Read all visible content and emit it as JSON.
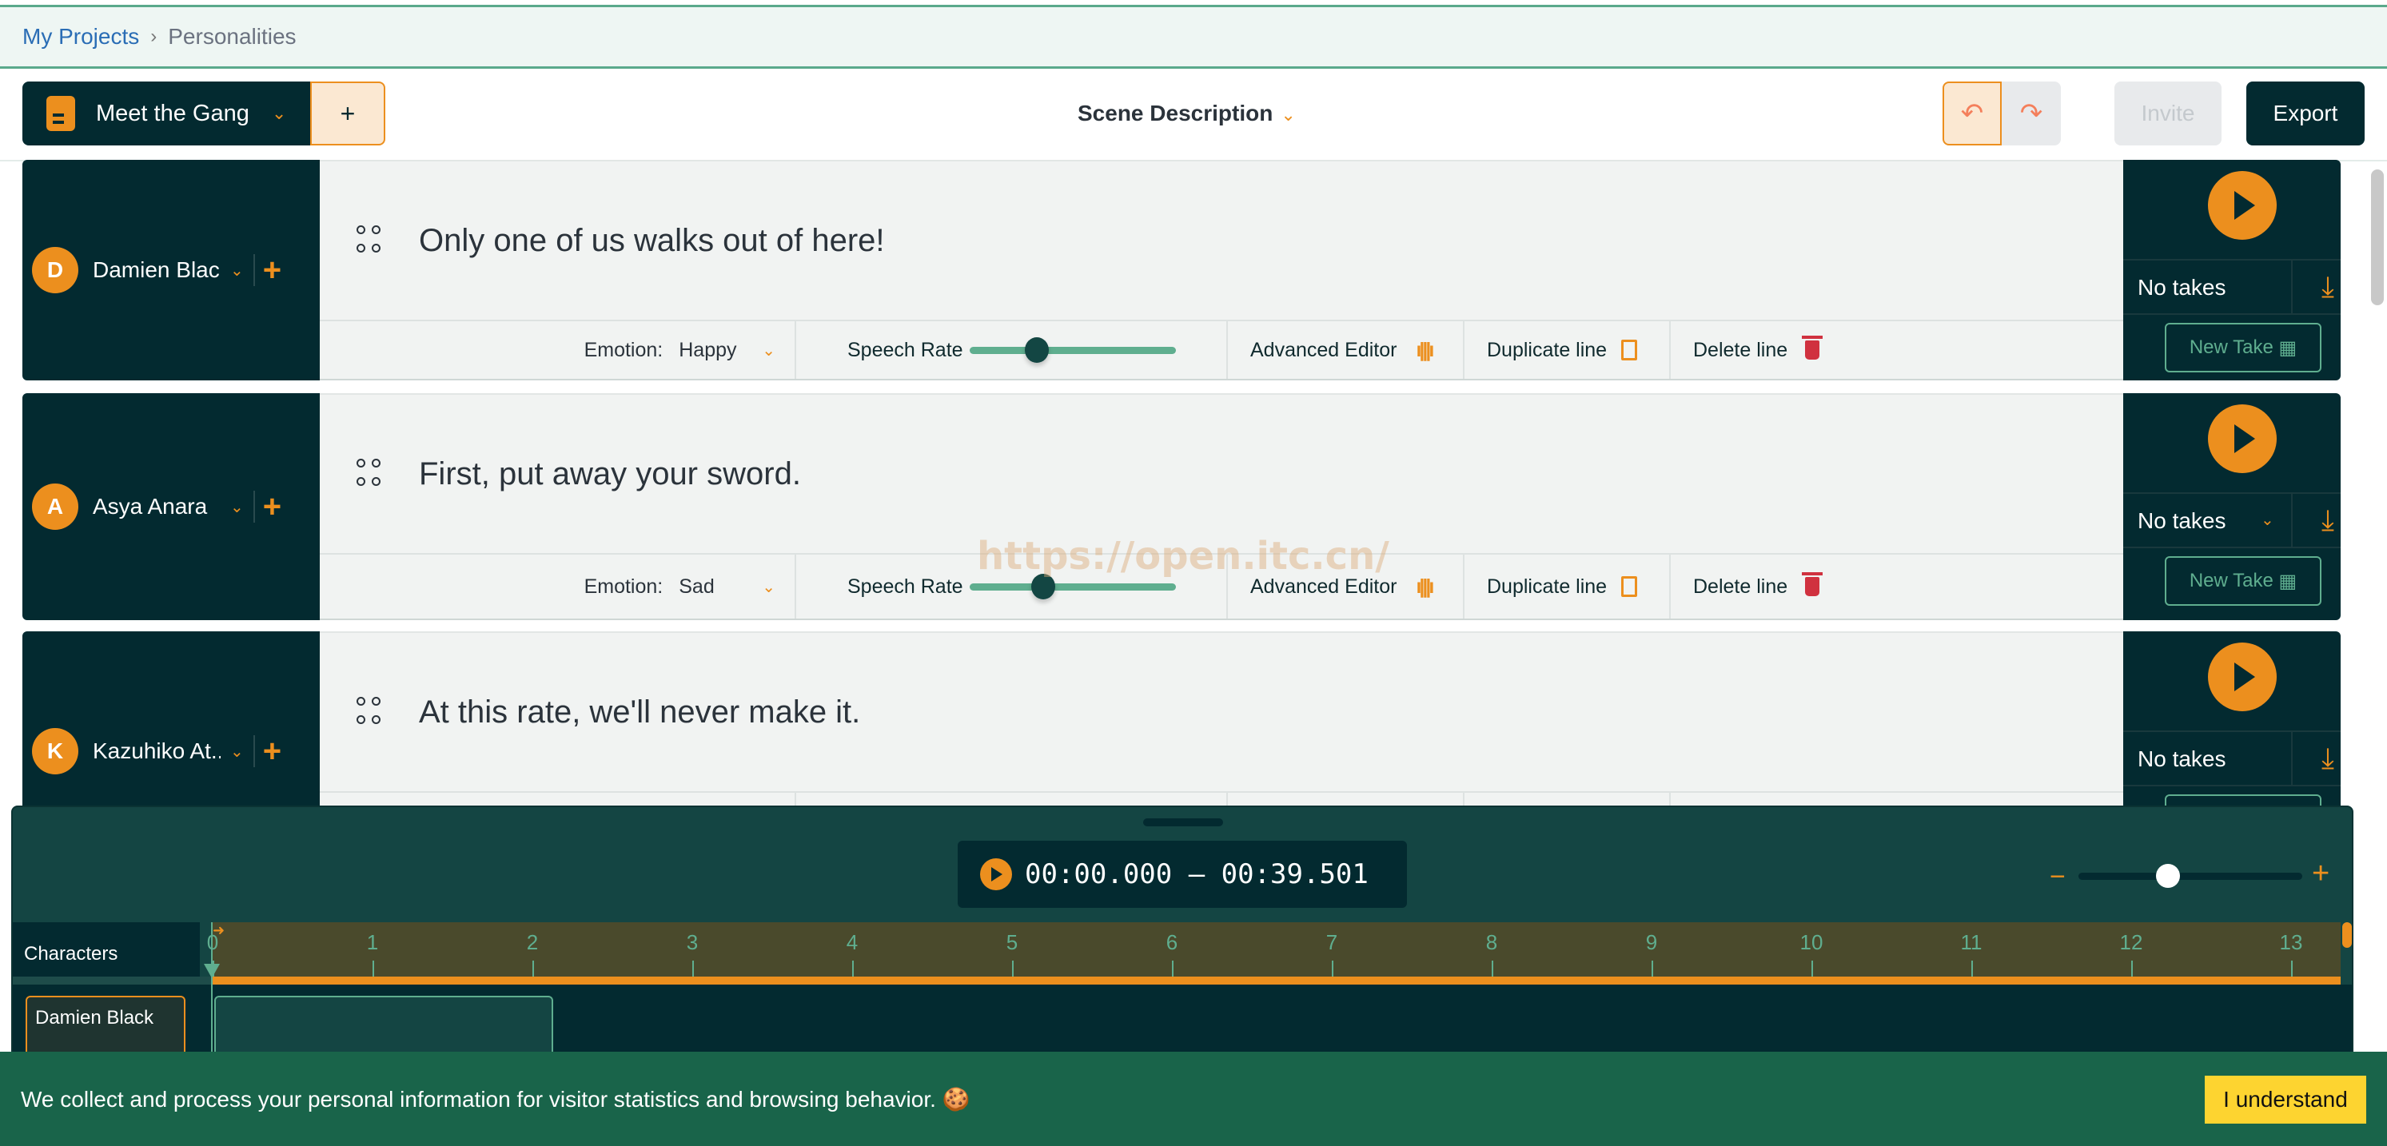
{
  "breadcrumb": {
    "root": "My Projects",
    "separator": "›",
    "current": "Personalities"
  },
  "toolbar": {
    "project_name": "Meet the Gang",
    "add_label": "+",
    "scene_label": "Scene Description",
    "undo_icon": "↶",
    "redo_icon": "↷",
    "invite_label": "Invite",
    "export_label": "Export"
  },
  "controls": {
    "emotion_label": "Emotion:",
    "speech_rate_label": "Speech Rate",
    "advanced_label": "Advanced Editor",
    "duplicate_label": "Duplicate line",
    "delete_label": "Delete line",
    "new_take_label": "New Take",
    "no_takes_label": "No takes",
    "chevron": "⌄",
    "plus": "+",
    "wave": "ı|||ı"
  },
  "lines": [
    {
      "initial": "D",
      "character": "Damien Black",
      "text": "Only one of us walks out of here!",
      "emotion": "Happy",
      "speech_rate": 0.27
    },
    {
      "initial": "A",
      "character": "Asya Anara",
      "text": "First, put away your sword.",
      "emotion": "Sad",
      "speech_rate": 0.3
    },
    {
      "initial": "K",
      "character": "Kazuhiko At...",
      "text": "At this rate, we'll never make it.",
      "emotion": "",
      "speech_rate": null
    }
  ],
  "watermark": "https://open.itc.cn/",
  "timeline": {
    "time_range": "00:00.000 – 00:39.501",
    "zoom_minus": "−",
    "zoom_plus": "+",
    "zoom_level": 0.4,
    "characters_header": "Characters",
    "ticks": [
      "0",
      "1",
      "2",
      "3",
      "4",
      "5",
      "6",
      "7",
      "8",
      "9",
      "10",
      "11",
      "12",
      "13"
    ],
    "tracks": [
      {
        "name": "Damien Black"
      }
    ]
  },
  "cookie": {
    "text": "We collect and process your personal information for visitor statistics and browsing behavior. 🍪",
    "button": "I understand"
  }
}
